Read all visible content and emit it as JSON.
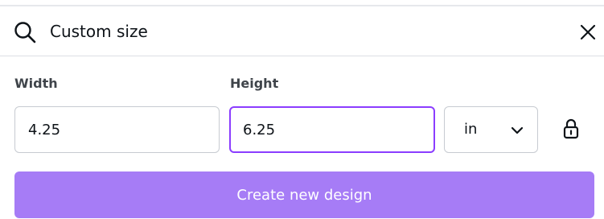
{
  "search": {
    "value": "Custom size",
    "icon": "search-icon",
    "close_icon": "close-icon"
  },
  "fields": {
    "width": {
      "label": "Width",
      "value": "4.25"
    },
    "height": {
      "label": "Height",
      "value": "6.25"
    }
  },
  "unit": {
    "selected": "in",
    "icon": "chevron-down-icon"
  },
  "lock": {
    "icon": "lock-icon"
  },
  "create_button": {
    "label": "Create new design"
  },
  "colors": {
    "accent": "#8b3dff",
    "button_bg": "#a67cf6",
    "border": "#c7cbd1",
    "text": "#0e1318"
  }
}
